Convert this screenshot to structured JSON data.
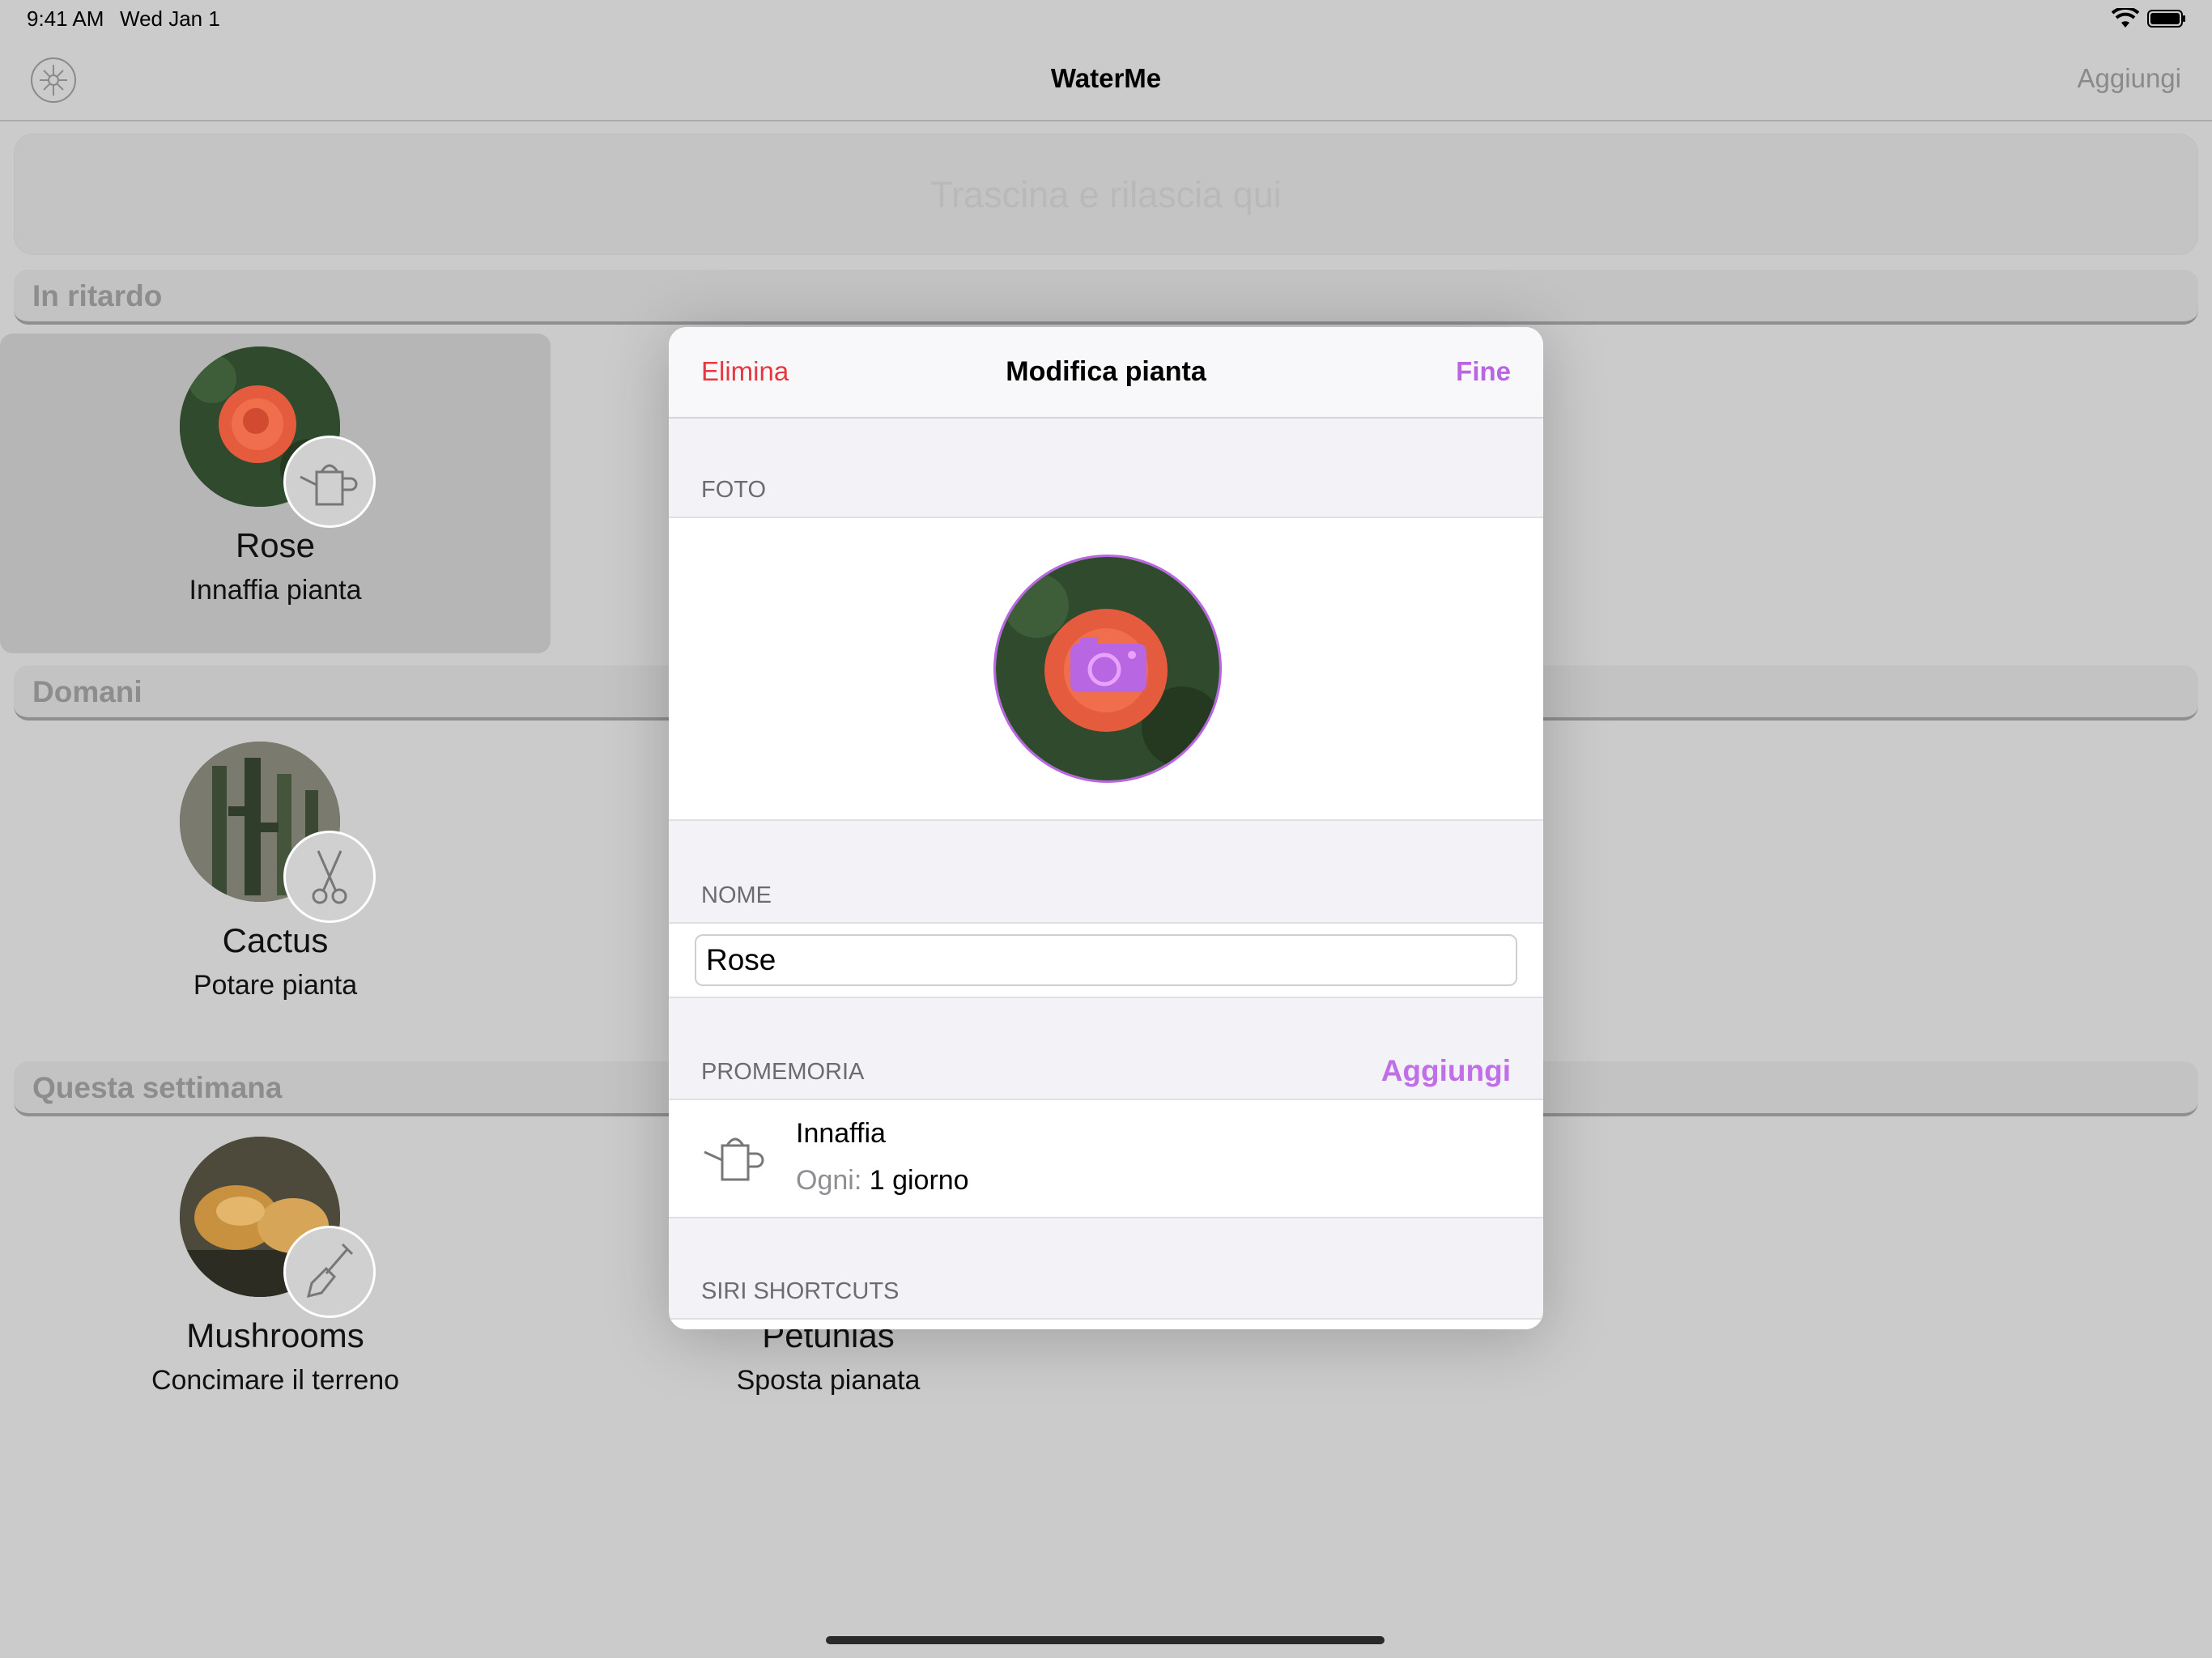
{
  "status_bar": {
    "time": "9:41 AM",
    "date": "Wed Jan 1",
    "wifi_icon": "wifi-icon",
    "battery_icon": "battery-icon"
  },
  "nav": {
    "title": "WaterMe",
    "add_label": "Aggiungi",
    "logo_icon": "watering-can-emblem-icon"
  },
  "dropzone": {
    "label": "Trascina e rilascia qui"
  },
  "sections": {
    "overdue": "In ritardo",
    "tomorrow": "Domani",
    "this_week": "Questa settimana"
  },
  "plants": [
    {
      "name": "Rose",
      "task": "Innaffia pianta",
      "badge_icon": "watering-can-icon"
    },
    {
      "name": "Cactus",
      "task": "Potare pianta",
      "badge_icon": "scissors-icon"
    },
    {
      "name": "Mushrooms",
      "task": "Concimare il terreno",
      "badge_icon": "shovel-icon"
    },
    {
      "name": "Petunias",
      "task": "Sposta pianata"
    }
  ],
  "modal": {
    "delete_label": "Elimina",
    "title": "Modifica pianta",
    "done_label": "Fine",
    "photo_section": "FOTO",
    "photo_icon": "camera-icon",
    "name_section": "NOME",
    "name_value": "Rose",
    "reminders_section": "PROMEMORIA",
    "reminders_add": "Aggiungi",
    "reminder": {
      "title": "Innaffia",
      "every_label": "Ogni:",
      "every_value": "1 giorno",
      "icon": "watering-can-icon"
    },
    "siri_section": "SIRI SHORTCUTS"
  },
  "colors": {
    "accent": "#b866e2",
    "destructive": "#e8383f",
    "dim_background": "#cbcbcb"
  }
}
